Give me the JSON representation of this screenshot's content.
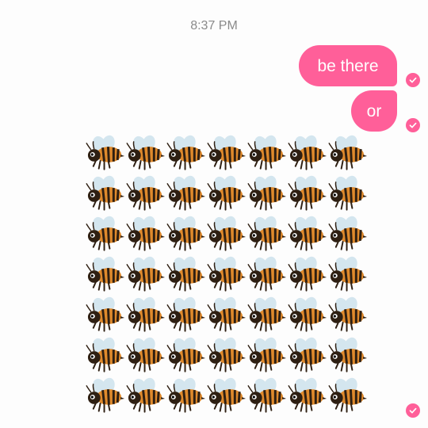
{
  "conversation": {
    "timestamp": "8:37 PM",
    "messages": [
      {
        "text": "be there",
        "direction": "outgoing",
        "status": "sent-checkmark"
      },
      {
        "text": "or",
        "direction": "outgoing",
        "status": "sent-checkmark"
      }
    ],
    "emoji_message": {
      "emoji": "honeybee-icon",
      "rows": 7,
      "columns": 7,
      "count": 49,
      "status": "sent-checkmark"
    }
  },
  "colors": {
    "bubble": "#ff5f99",
    "bubble_text": "#ffffff",
    "timestamp_text": "#8a8a8a",
    "bee_body": "#2e1f12",
    "bee_stripe": "#e08a2c",
    "bee_wing": "#d4e6ef"
  }
}
